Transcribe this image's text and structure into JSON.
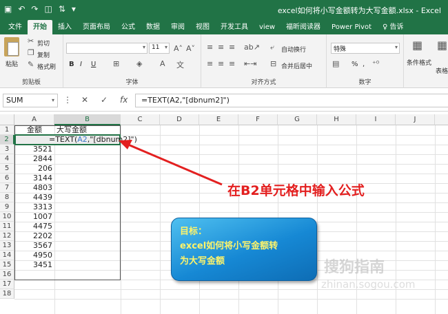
{
  "titlebar": {
    "title": "excel如何将小写金额转为大写金额.xlsx - Excel",
    "qat_icons": [
      "save-icon",
      "undo-icon",
      "redo-icon",
      "print-preview-icon",
      "sort-icon",
      "customize-icon"
    ]
  },
  "tabs": [
    "文件",
    "开始",
    "插入",
    "页面布局",
    "公式",
    "数据",
    "审阅",
    "视图",
    "开发工具",
    "view",
    "福昕阅读器",
    "Power Pivot",
    "♀ 告诉"
  ],
  "active_tab": "开始",
  "ribbon": {
    "clipboard": {
      "paste": "粘贴",
      "cut": "剪切",
      "copy": "复制",
      "format_painter": "格式刷",
      "label": "剪贴板"
    },
    "font": {
      "font_size": "11",
      "label": "字体",
      "bold": "B",
      "italic": "I",
      "underline": "U"
    },
    "alignment": {
      "wrap": "自动换行",
      "merge": "合并后居中",
      "label": "对齐方式"
    },
    "number": {
      "format": "特殊",
      "label": "数字",
      "percent": "%",
      "comma": ","
    },
    "styles": {
      "conditional": "条件格式",
      "table": "表格"
    }
  },
  "formula_bar": {
    "name_box": "SUM",
    "cancel": "✕",
    "enter": "✓",
    "fx": "fx",
    "formula": "=TEXT(A2,\"[dbnum2]\")"
  },
  "sheet": {
    "columns": [
      "A",
      "B",
      "C",
      "D",
      "E",
      "F",
      "G",
      "H",
      "I",
      "J"
    ],
    "rows": [
      "1",
      "2",
      "3",
      "4",
      "5",
      "6",
      "7",
      "8",
      "9",
      "10",
      "11",
      "12",
      "13",
      "14",
      "15",
      "16",
      "17",
      "18"
    ],
    "header_a": "金额",
    "header_b": "大写金额",
    "edit_formula_prefix": "=TEXT(",
    "edit_formula_ref": "A2",
    "edit_formula_suffix": ",\"[dbnum2]\")",
    "values": [
      "3521",
      "2844",
      "206",
      "3144",
      "4803",
      "4439",
      "3313",
      "1007",
      "4475",
      "2202",
      "3567",
      "4950",
      "3451"
    ]
  },
  "annotation": {
    "callout": "在B2单元格中输入公式",
    "goal_line1": "目标：",
    "goal_line2": "excel如何将小写金额转",
    "goal_line3": "为大写金额",
    "arrow_color": "#e32020"
  },
  "watermark": {
    "text": "搜狗指南",
    "sub": "zhinan.sogou.com"
  },
  "colors": {
    "accent": "#217346",
    "ref": "#3c78c8",
    "callout": "#e32020",
    "goal_text": "#fff46a"
  }
}
